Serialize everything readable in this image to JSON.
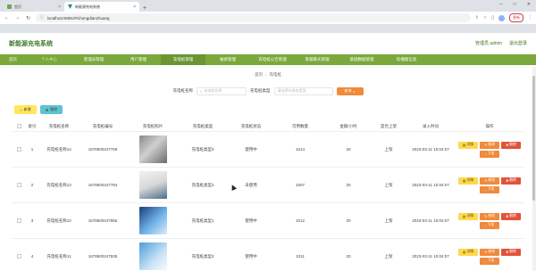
{
  "browser": {
    "tabs": [
      {
        "title": "首页",
        "active": false
      },
      {
        "title": "新能源充电系统",
        "active": true
      }
    ],
    "new_tab": "+",
    "address": "localhost:8081/#/chongdianzhuang",
    "update_label": "更新"
  },
  "app": {
    "title": "新能源充电系统",
    "user_label": "管理员 admin",
    "logout_label": "退出登录"
  },
  "nav": [
    {
      "label": "首页",
      "active": false
    },
    {
      "label": "个人中心",
      "active": false
    },
    {
      "label": "管理员管理",
      "active": false
    },
    {
      "label": "用户管理",
      "active": false
    },
    {
      "label": "充电桩管理",
      "active": true
    },
    {
      "label": "报修管理",
      "active": false
    },
    {
      "label": "充电桩公告管理",
      "active": false
    },
    {
      "label": "客服聊天管理",
      "active": false
    },
    {
      "label": "基础数据管理",
      "active": false
    },
    {
      "label": "轮播图信息",
      "active": false
    }
  ],
  "breadcrumb": {
    "home": "首页",
    "sep": "/",
    "current": "充电桩"
  },
  "search": {
    "name_label": "充电桩名称",
    "name_placeholder": "充电桩名称",
    "type_label": "充电桩类型",
    "type_placeholder": "请选择充电桩类型",
    "button_label": "查询"
  },
  "toolbar": {
    "add_label": "新增",
    "delete_label": "删除"
  },
  "table": {
    "headers": [
      "",
      "索引",
      "充电桩名称",
      "充电桩编号",
      "充电桩照片",
      "充电桩类型",
      "充电桩状态",
      "可用数量",
      "金额/小时",
      "是否上架",
      "录入时间",
      "操作"
    ],
    "rows": [
      {
        "index": "1",
        "name": "充电桩名称14",
        "code": "1678500247769",
        "type": "充电桩类型3",
        "status": "使用中",
        "qty": "1014",
        "price": "20",
        "shelf": "上架",
        "time": "2023-03-11 10:04:07"
      },
      {
        "index": "2",
        "name": "充电桩名称13",
        "code": "1678500247784",
        "type": "充电桩类型2",
        "status": "未使用",
        "qty": "1007",
        "price": "20",
        "shelf": "上架",
        "time": "2023-03-11 10:04:07"
      },
      {
        "index": "3",
        "name": "充电桩名称12",
        "code": "1678500247855",
        "type": "充电桩类型1",
        "status": "使用中",
        "qty": "1012",
        "price": "20",
        "shelf": "上架",
        "time": "2023-03-11 10:04:07"
      },
      {
        "index": "4",
        "name": "充电桩名称11",
        "code": "1678500247835",
        "type": "充电桩类型3",
        "status": "使用中",
        "qty": "1011",
        "price": "20",
        "shelf": "上架",
        "time": "2023-03-11 10:04:07"
      }
    ],
    "ops": {
      "detail": "详情",
      "edit": "修改",
      "remove": "删除",
      "off": "下架"
    }
  }
}
